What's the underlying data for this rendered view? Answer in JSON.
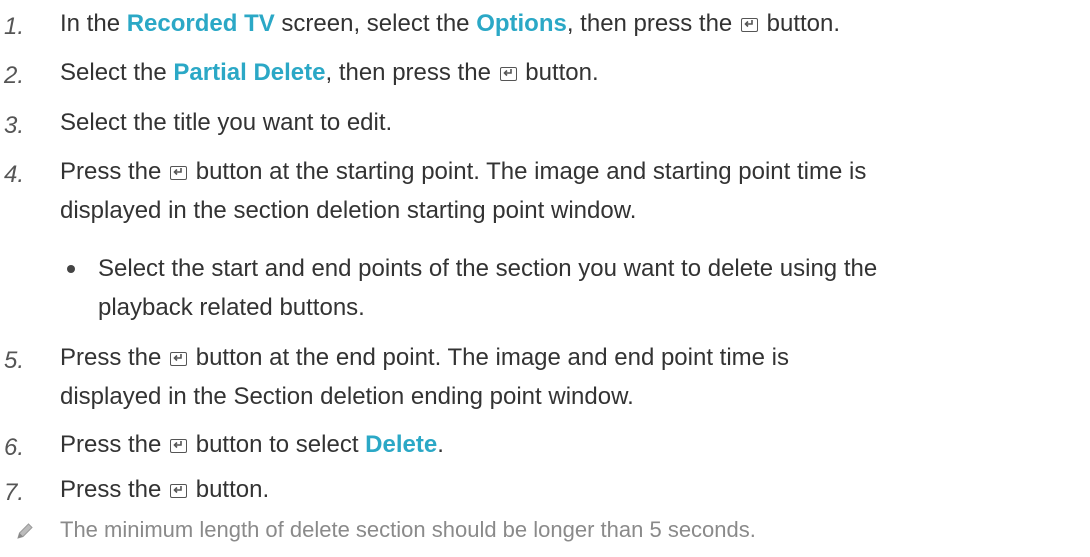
{
  "colors": {
    "highlight": "#2ba8c6",
    "text": "#333333",
    "note": "#8a8a8a"
  },
  "icons": {
    "enter_button": "enter-button-icon",
    "note": "pencil-icon"
  },
  "steps": [
    {
      "num": "1.",
      "parts": [
        "In the ",
        "Recorded TV",
        " screen, select the ",
        "Options",
        ", then press the ",
        " button."
      ]
    },
    {
      "num": "2.",
      "parts": [
        "Select the ",
        "Partial Delete",
        ", then press the ",
        " button."
      ]
    },
    {
      "num": "3.",
      "parts": [
        "Select the title you want to edit."
      ]
    },
    {
      "num": "4.",
      "parts": [
        "Press the ",
        " button at the starting point. The image and starting point time is",
        "displayed in the section deletion starting point window."
      ]
    },
    {
      "num": "5.",
      "parts": [
        "Press the ",
        " button at the end point. The image and end point time is",
        "displayed in the Section deletion ending point window."
      ]
    },
    {
      "num": "6.",
      "parts": [
        "Press the ",
        " button to select ",
        "Delete",
        "."
      ]
    },
    {
      "num": "7.",
      "parts": [
        "Press the ",
        " button."
      ]
    }
  ],
  "bullet": {
    "line1": "Select the start and end points of the section you want to delete using the",
    "line2": "playback related buttons."
  },
  "note": "The minimum length of delete section should be longer than 5 seconds."
}
